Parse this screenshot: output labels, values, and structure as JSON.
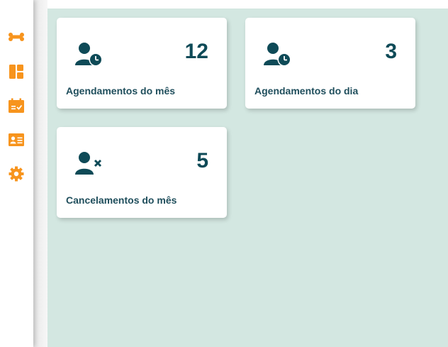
{
  "sidebar": {
    "items": [
      {
        "icon": "bone-icon"
      },
      {
        "icon": "dashboard-icon"
      },
      {
        "icon": "calendar-check-icon"
      },
      {
        "icon": "contact-card-icon"
      },
      {
        "icon": "gear-icon"
      }
    ]
  },
  "colors": {
    "accent": "#f7941d",
    "text": "#0e4a57",
    "main_bg": "#d3e7e1"
  },
  "cards": [
    {
      "value": "12",
      "label": "Agendamentos do mês",
      "icon": "user-clock-icon"
    },
    {
      "value": "3",
      "label": "Agendamentos do dia",
      "icon": "user-clock-icon"
    },
    {
      "value": "5",
      "label": "Cancelamentos do mês",
      "icon": "user-times-icon"
    }
  ]
}
